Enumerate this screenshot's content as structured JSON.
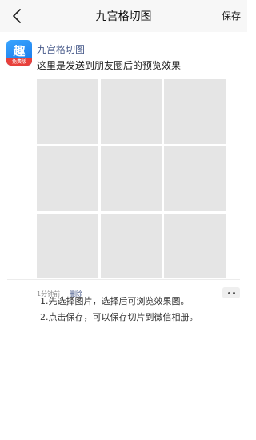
{
  "navbar": {
    "back_icon": "back-arrow-icon",
    "title": "九宫格切图",
    "save_label": "保存"
  },
  "post": {
    "app_icon": {
      "icon": "app-logo-icon",
      "glyph": "趣",
      "ribbon": "免费版"
    },
    "name": "九宫格切图",
    "text": "这里是发送到朋友圈后的预览效果",
    "time": "1分钟前",
    "delete_label": "删除",
    "more_icon": "more-dots-icon"
  },
  "instructions": [
    "1.先选择图片，选择后可浏览效果图。",
    "2.点击保存，可以保存切片到微信相册。"
  ]
}
